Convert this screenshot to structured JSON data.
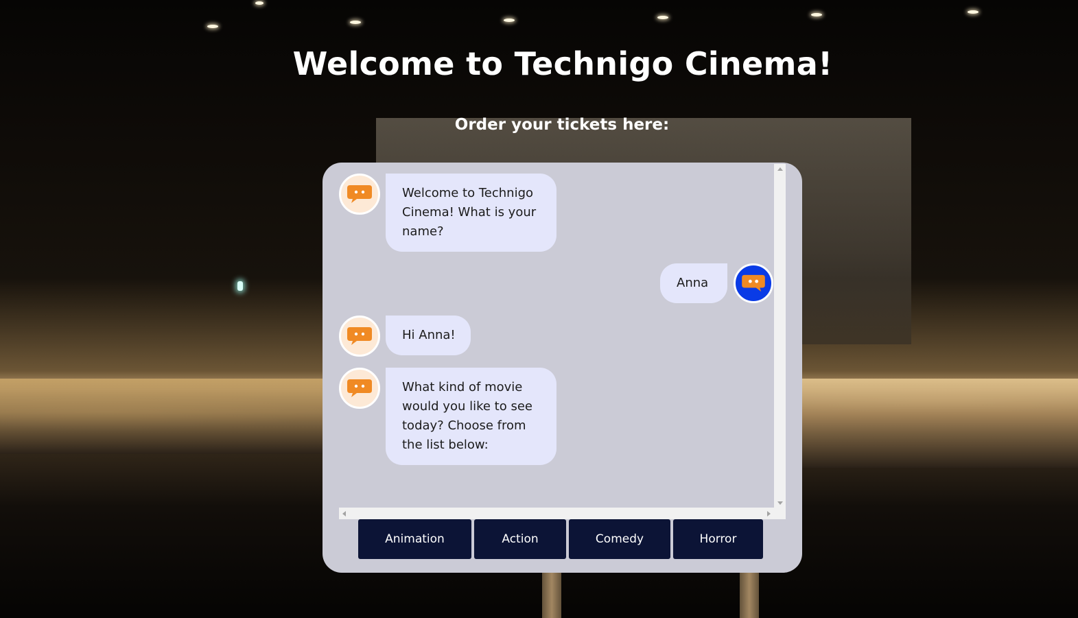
{
  "page": {
    "title": "Welcome to Technigo Cinema!",
    "subtitle": "Order your tickets here:"
  },
  "chat": {
    "messages": [
      {
        "sender": "bot",
        "text": "Welcome to Technigo Cinema! What is your name?"
      },
      {
        "sender": "user",
        "text": "Anna"
      },
      {
        "sender": "bot",
        "text": "Hi Anna!"
      },
      {
        "sender": "bot",
        "text": "What kind of movie would you like to see today? Choose from the list below:"
      }
    ],
    "options": [
      "Animation",
      "Action",
      "Comedy",
      "Horror"
    ]
  },
  "icons": {
    "bot_avatar": "chat-bubble-icon",
    "user_avatar": "chat-bubble-icon"
  },
  "colors": {
    "panel_bg": "#cbcbd6",
    "bubble_bg": "#e4e6fb",
    "button_bg": "#0c1436",
    "bot_icon": "#f08a24",
    "user_avatar_bg": "#0a3be6"
  }
}
